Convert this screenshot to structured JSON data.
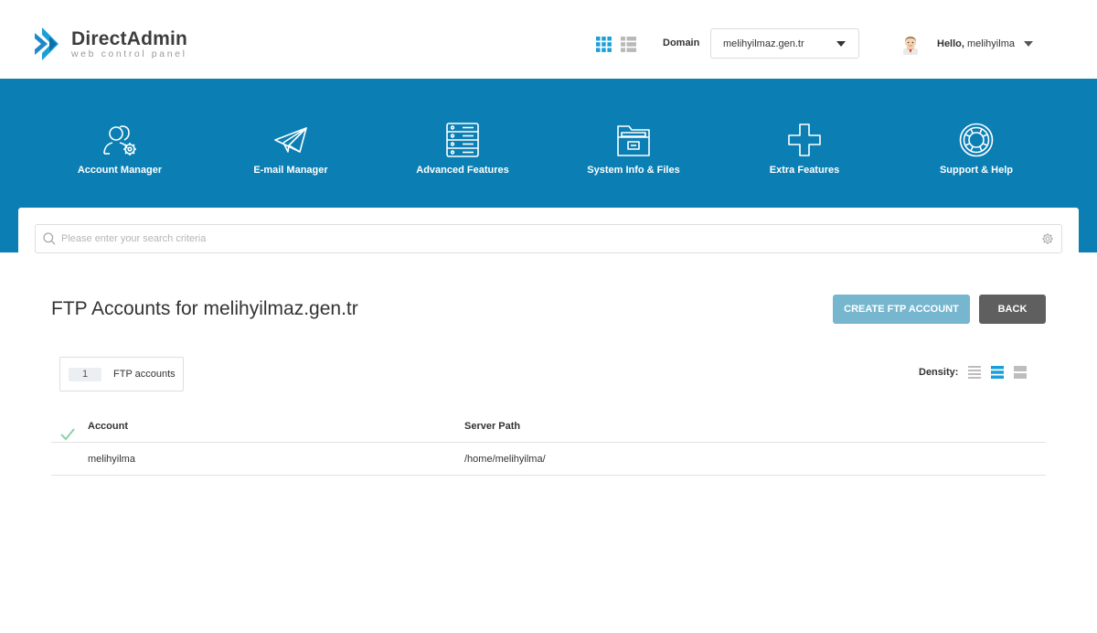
{
  "app": {
    "name": "DirectAdmin",
    "tagline": "web control panel"
  },
  "header": {
    "domain_label": "Domain",
    "domain_value": "melihyilmaz.gen.tr",
    "hello_prefix": "Hello,",
    "username": "melihyilma"
  },
  "nav": [
    {
      "label": "Account Manager",
      "icon": "users-gear-icon"
    },
    {
      "label": "E-mail Manager",
      "icon": "paper-plane-icon"
    },
    {
      "label": "Advanced Features",
      "icon": "server-rack-icon"
    },
    {
      "label": "System Info & Files",
      "icon": "folder-files-icon"
    },
    {
      "label": "Extra Features",
      "icon": "plus-icon"
    },
    {
      "label": "Support & Help",
      "icon": "lifebuoy-icon"
    }
  ],
  "search": {
    "placeholder": "Please enter your search criteria"
  },
  "page": {
    "title": "FTP Accounts for melihyilmaz.gen.tr",
    "create_button": "CREATE FTP ACCOUNT",
    "back_button": "BACK"
  },
  "summary": {
    "count": "1",
    "count_label": "FTP accounts"
  },
  "density": {
    "label": "Density:",
    "selected": "medium"
  },
  "table": {
    "columns": [
      "Account",
      "Server Path"
    ],
    "rows": [
      {
        "account": "melihyilma",
        "path": "/home/melihyilma/"
      }
    ]
  },
  "colors": {
    "brand_blue": "#0b7fb4",
    "create_button": "#76b7cf",
    "back_button": "#5f5f5f",
    "accent": "#1a9fd8"
  }
}
